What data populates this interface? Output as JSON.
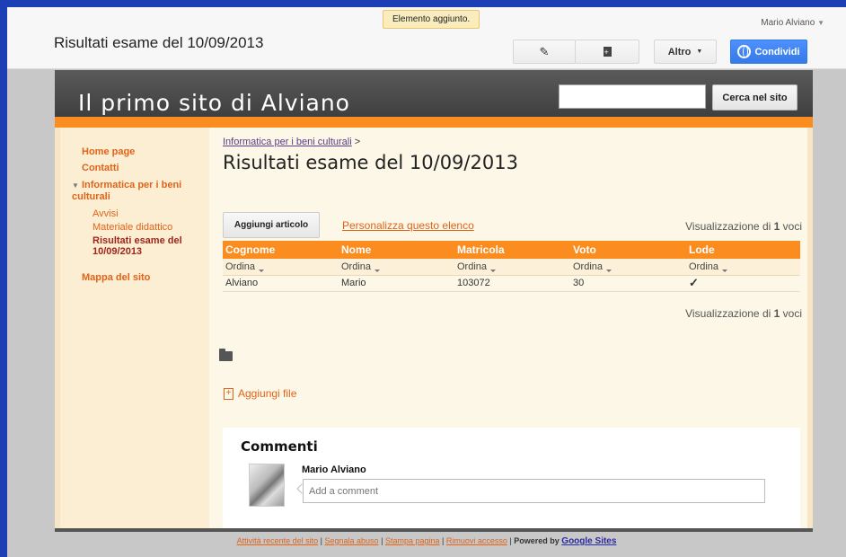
{
  "topbar": {
    "doc_title": "Risultati esame del 10/09/2013",
    "notice": "Elemento aggiunto.",
    "user": "Mario Alviano",
    "more_label": "Altro",
    "share_label": "Condividi",
    "icons": [
      "pencil-icon",
      "new-page-icon",
      "chevron-down-icon",
      "globe-icon"
    ]
  },
  "header": {
    "site_title": "Il primo sito di Alviano",
    "search_placeholder": "",
    "search_button": "Cerca nel sito",
    "accent_color": "#fb8c1f"
  },
  "sidebar": {
    "items": [
      {
        "label": "Home page"
      },
      {
        "label": "Contatti"
      },
      {
        "label": "Informatica per i beni culturali"
      },
      {
        "label": "Avvisi"
      },
      {
        "label": "Materiale didattico"
      },
      {
        "label": "Risultati esame del 10/09/2013"
      },
      {
        "label": "Mappa del sito"
      }
    ]
  },
  "main": {
    "breadcrumb_link": "Informatica per i beni culturali",
    "breadcrumb_sep": ">",
    "title": "Risultati esame del 10/09/2013",
    "add_item": "Aggiungi articolo",
    "customize": "Personalizza questo elenco",
    "count_prefix": "Visualizzazione di ",
    "count_value": "1",
    "count_suffix": " voci",
    "columns": [
      "Cognome",
      "Nome",
      "Matricola",
      "Voto",
      "Lode"
    ],
    "sort_label": "Ordina",
    "rows": [
      {
        "cognome": "Alviano",
        "nome": "Mario",
        "matricola": "103072",
        "voto": "30",
        "lode": "✓"
      }
    ],
    "add_file": "Aggiungi file"
  },
  "comments": {
    "title": "Commenti",
    "author": "Mario Alviano",
    "placeholder": "Add a comment"
  },
  "footer": {
    "recent": "Attività recente del sito",
    "abuse": "Segnala abuso",
    "print": "Stampa pagina",
    "remove": "Rimuovi accesso",
    "powered": "Powered by",
    "brand": "Google Sites",
    "sep": "|"
  }
}
